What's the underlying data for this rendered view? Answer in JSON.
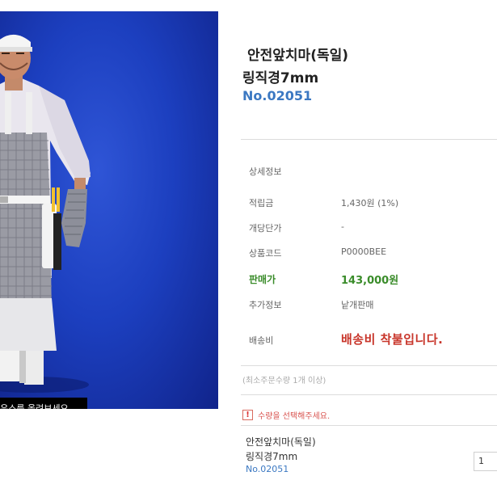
{
  "product": {
    "title_line1": "안전앞치마(독일)",
    "title_line2": "링직경7mm",
    "code": "No.02051"
  },
  "image": {
    "zoom_tip": "마우스를 올려보세요."
  },
  "details": {
    "section_label": "상세정보",
    "rows": [
      {
        "label": "적립금",
        "value": "1,430원 (1%)"
      },
      {
        "label": "개당단가",
        "value": "-"
      },
      {
        "label": "상품코드",
        "value": "P0000BEE"
      },
      {
        "label": "판매가",
        "value": "143,000원"
      },
      {
        "label": "추가정보",
        "value": "낱개판매"
      },
      {
        "label": "배송비",
        "value": "배송비 착불입니다."
      }
    ]
  },
  "min_order": "(최소주문수량 1개 이상)",
  "notice": {
    "icon": "!",
    "text": "수량을 선택해주세요."
  },
  "selected": {
    "name_line1": "안전앞치마(독일)",
    "name_line2": "링직경7mm",
    "code": "No.02051",
    "quantity": "1"
  },
  "colors": {
    "code_blue": "#3b78c2",
    "sale_green": "#3a8c2a",
    "shipping_red": "#c8362b",
    "image_bg": "#1c3fbf"
  }
}
